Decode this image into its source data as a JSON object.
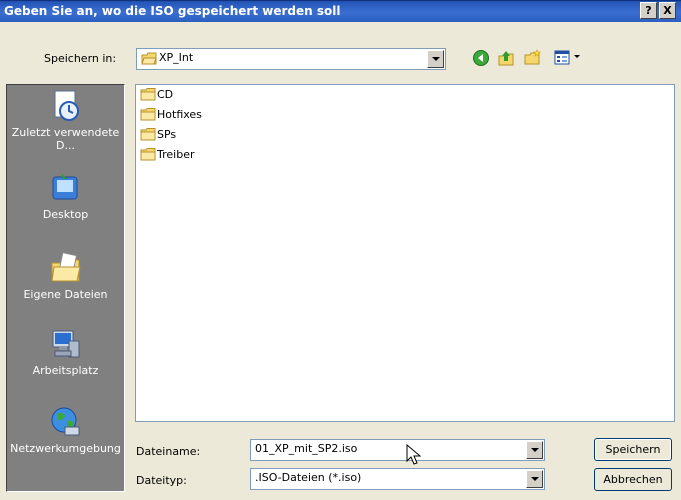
{
  "window": {
    "title": "Geben Sie an, wo die ISO gespeichert werden soll",
    "help_label": "?",
    "close_label": "X"
  },
  "lookin": {
    "label": "Speichern in:",
    "value": "XP_Int"
  },
  "toolbar": {
    "icons": [
      "back-icon",
      "up-folder-icon",
      "new-folder-icon",
      "view-menu-icon"
    ]
  },
  "places": [
    {
      "label": "Zuletzt verwendete D...",
      "icon": "recent-documents-icon"
    },
    {
      "label": "Desktop",
      "icon": "desktop-icon"
    },
    {
      "label": "Eigene Dateien",
      "icon": "my-documents-icon"
    },
    {
      "label": "Arbeitsplatz",
      "icon": "my-computer-icon"
    },
    {
      "label": "Netzwerkumgebung",
      "icon": "network-places-icon"
    }
  ],
  "files": [
    {
      "name": "CD"
    },
    {
      "name": "Hotfixes"
    },
    {
      "name": "SPs"
    },
    {
      "name": "Treiber"
    }
  ],
  "filename": {
    "label": "Dateiname:",
    "value": "01_XP_mit_SP2.iso"
  },
  "filetype": {
    "label": "Dateityp:",
    "value": ".ISO-Dateien (*.iso)"
  },
  "buttons": {
    "save": "Speichern",
    "cancel": "Abbrechen"
  },
  "colors": {
    "title_bar": "#2456b8",
    "places_bar": "#808080",
    "dialog_bg": "#ece9d8",
    "folder": "#f5d76e"
  }
}
